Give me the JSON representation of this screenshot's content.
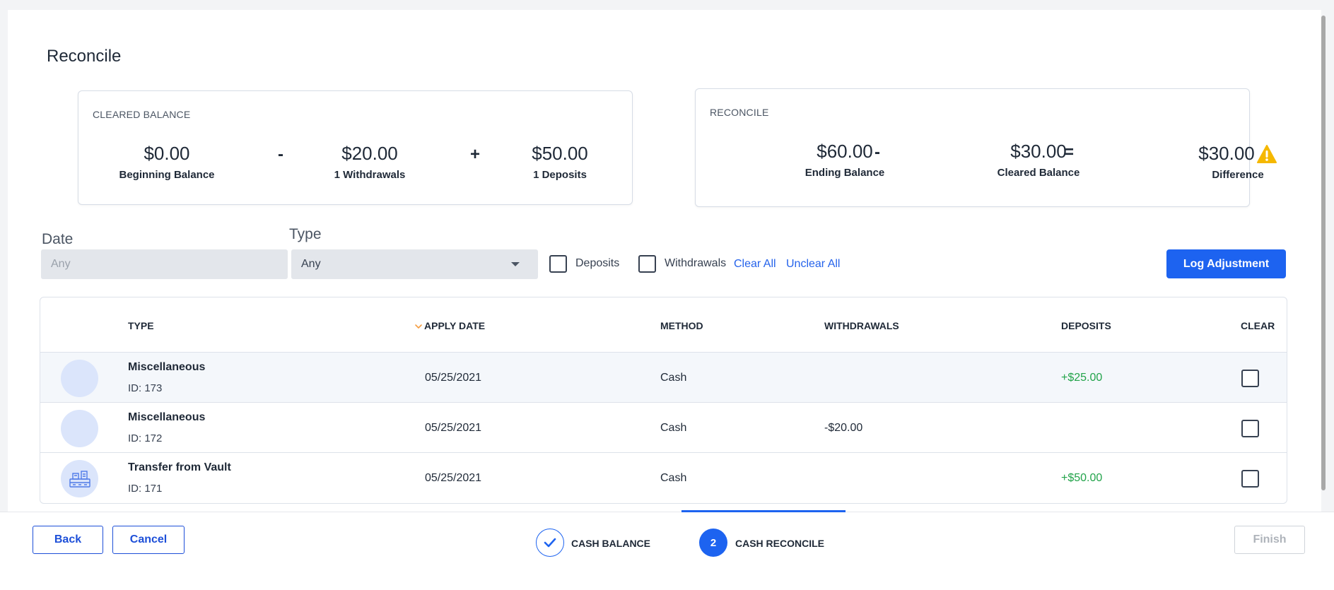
{
  "page": {
    "title": "Reconcile"
  },
  "cleared_balance_card": {
    "label": "CLEARED BALANCE",
    "beginning": {
      "amount": "$0.00",
      "caption": "Beginning Balance"
    },
    "op1": "-",
    "withdrawals": {
      "amount": "$20.00",
      "caption": "1 Withdrawals"
    },
    "op2": "+",
    "deposits": {
      "amount": "$50.00",
      "caption": "1 Deposits"
    }
  },
  "reconcile_card": {
    "label": "RECONCILE",
    "ending": {
      "amount": "$60.00",
      "caption": "Ending Balance"
    },
    "op1": "-",
    "cleared": {
      "amount": "$30.00",
      "caption": "Cleared Balance"
    },
    "op2": "=",
    "difference": {
      "amount": "$30.00",
      "caption": "Difference",
      "icon": "warning-icon"
    }
  },
  "filters": {
    "date": {
      "label": "Date",
      "placeholder": "Any"
    },
    "type": {
      "label": "Type",
      "value": "Any"
    },
    "deposits_label": "Deposits",
    "withdrawals_label": "Withdrawals",
    "clear_all": "Clear All",
    "unclear_all": "Unclear All",
    "log_adjustment": "Log Adjustment"
  },
  "table": {
    "headers": {
      "type": "TYPE",
      "apply_date": "APPLY DATE",
      "method": "METHOD",
      "withdrawals": "WITHDRAWALS",
      "deposits": "DEPOSITS",
      "clear": "CLEAR"
    },
    "rows": [
      {
        "type": "Miscellaneous",
        "id": "ID: 173",
        "apply_date": "05/25/2021",
        "method": "Cash",
        "withdrawal": "",
        "deposit": "+$25.00",
        "icon": ""
      },
      {
        "type": "Miscellaneous",
        "id": "ID: 172",
        "apply_date": "05/25/2021",
        "method": "Cash",
        "withdrawal": "-$20.00",
        "deposit": "",
        "icon": ""
      },
      {
        "type": "Transfer from Vault",
        "id": "ID: 171",
        "apply_date": "05/25/2021",
        "method": "Cash",
        "withdrawal": "",
        "deposit": "+$50.00",
        "icon": "vault-icon"
      }
    ]
  },
  "footer": {
    "back": "Back",
    "cancel": "Cancel",
    "finish": "Finish",
    "steps": [
      {
        "number": "1",
        "label": "CASH BALANCE",
        "state": "done"
      },
      {
        "number": "2",
        "label": "CASH RECONCILE",
        "state": "active"
      }
    ]
  },
  "colors": {
    "primary": "#1d63f0",
    "deposit_green": "#22a34a",
    "warning": "#f5b800"
  }
}
